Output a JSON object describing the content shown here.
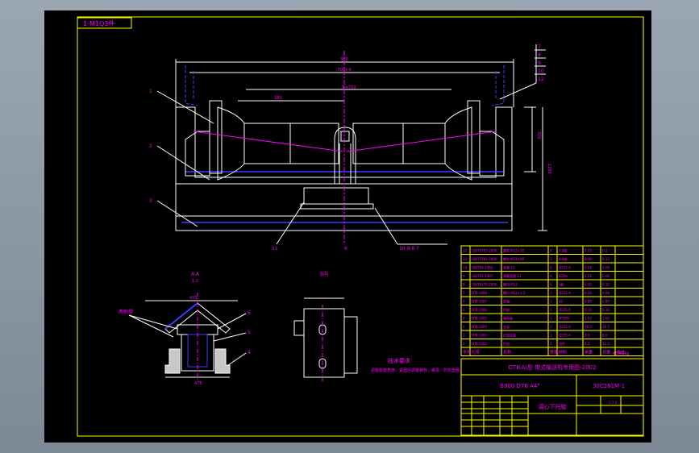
{
  "drawing": {
    "corner_tag": "1-M1Q3件",
    "dims": {
      "overall_width": "980",
      "mid_width": "700×4",
      "roller_span": "B=700",
      "center_len": "380",
      "side_height": "320",
      "total_height": "1200"
    },
    "part_numbers": {
      "right_top": [
        "7",
        "8",
        "9",
        "10",
        "12"
      ],
      "left": [
        "1",
        "2",
        "3"
      ],
      "bottom": [
        "11",
        "6",
        "10 9 8 7"
      ]
    },
    "sections": {
      "aa": "A-A",
      "aa_scale": "1:2",
      "b_view": "B向",
      "weld_note": "两侧焊",
      "callouts": [
        "4",
        "5",
        "6"
      ],
      "dim_top": "435",
      "dim_bottom": "475"
    },
    "tech": {
      "title": "技术要求",
      "line1": "调整胶垫角度、紧固后调整螺栓，螺母、防松垫圈。"
    }
  },
  "title_block": {
    "drawing_title": "DTⅡ(A)型  带式输送机专用图-2002",
    "spec": "B800 D76 A4°",
    "code": "30C261M-1",
    "part_name": "调心下托辊",
    "header_cells": [
      "序号",
      "代号",
      "名称",
      "数量",
      "材料",
      "单重",
      "总重",
      "备注"
    ],
    "weight": "40.41kg",
    "scale_cells": [
      "1:7.5"
    ],
    "bom_rows": [
      [
        "12",
        "GB/T5783-2000",
        "螺栓 M12×35",
        "4",
        "4.8级",
        "0.05",
        "0.2",
        ""
      ],
      [
        "11",
        "GB/T5781-2000",
        "螺栓 M12×40",
        "2",
        "4.8级",
        "0.06",
        "0.12",
        ""
      ],
      [
        "10",
        "GB/T96-1985",
        "垫圈 12",
        "6",
        "Q235-A",
        "0.01",
        "0.06",
        ""
      ],
      [
        "9",
        "GB/T93-1987",
        "弹簧垫圈 12",
        "6",
        "65Mn",
        "0.01",
        "0.06",
        ""
      ],
      [
        "8",
        "GB/T6170-2000",
        "螺母 M12",
        "6",
        "5级",
        "0.02",
        "0.12",
        ""
      ],
      [
        "7",
        "DTⅡ 1008",
        "螺钉 M12×1.5",
        "2",
        "Q235-A",
        "0.04",
        "0.08",
        ""
      ],
      [
        "6",
        "DTⅡ 1007",
        "转轴",
        "1",
        "45",
        "0.80",
        "0.80",
        ""
      ],
      [
        "5",
        "DTⅡ 1006",
        "挡圈",
        "1",
        "Q235-A",
        "0.10",
        "0.10",
        ""
      ],
      [
        "4",
        "DTⅡ 1005",
        "轴承座",
        "1",
        "HT200",
        "1.62",
        "1.62",
        ""
      ],
      [
        "3",
        "DTⅡ 1004",
        "支架",
        "1",
        "Q235-A",
        "16.5",
        "16.5",
        ""
      ],
      [
        "2",
        "DTⅡ 1003",
        "托辊支架",
        "1",
        "Q235-A",
        "8.0",
        "8.0",
        ""
      ],
      [
        "1",
        "DTⅡ 1002",
        "托辊",
        "2",
        "组件",
        "6.2",
        "12.4",
        ""
      ]
    ]
  },
  "colors": {
    "frame": "#ffff00",
    "outline": "#ffffff",
    "text": "#ff00ff",
    "hidden": "#0000ff",
    "dim": "#ffffff",
    "center": "#ff00ff",
    "section_blue": "#3b3bff"
  }
}
